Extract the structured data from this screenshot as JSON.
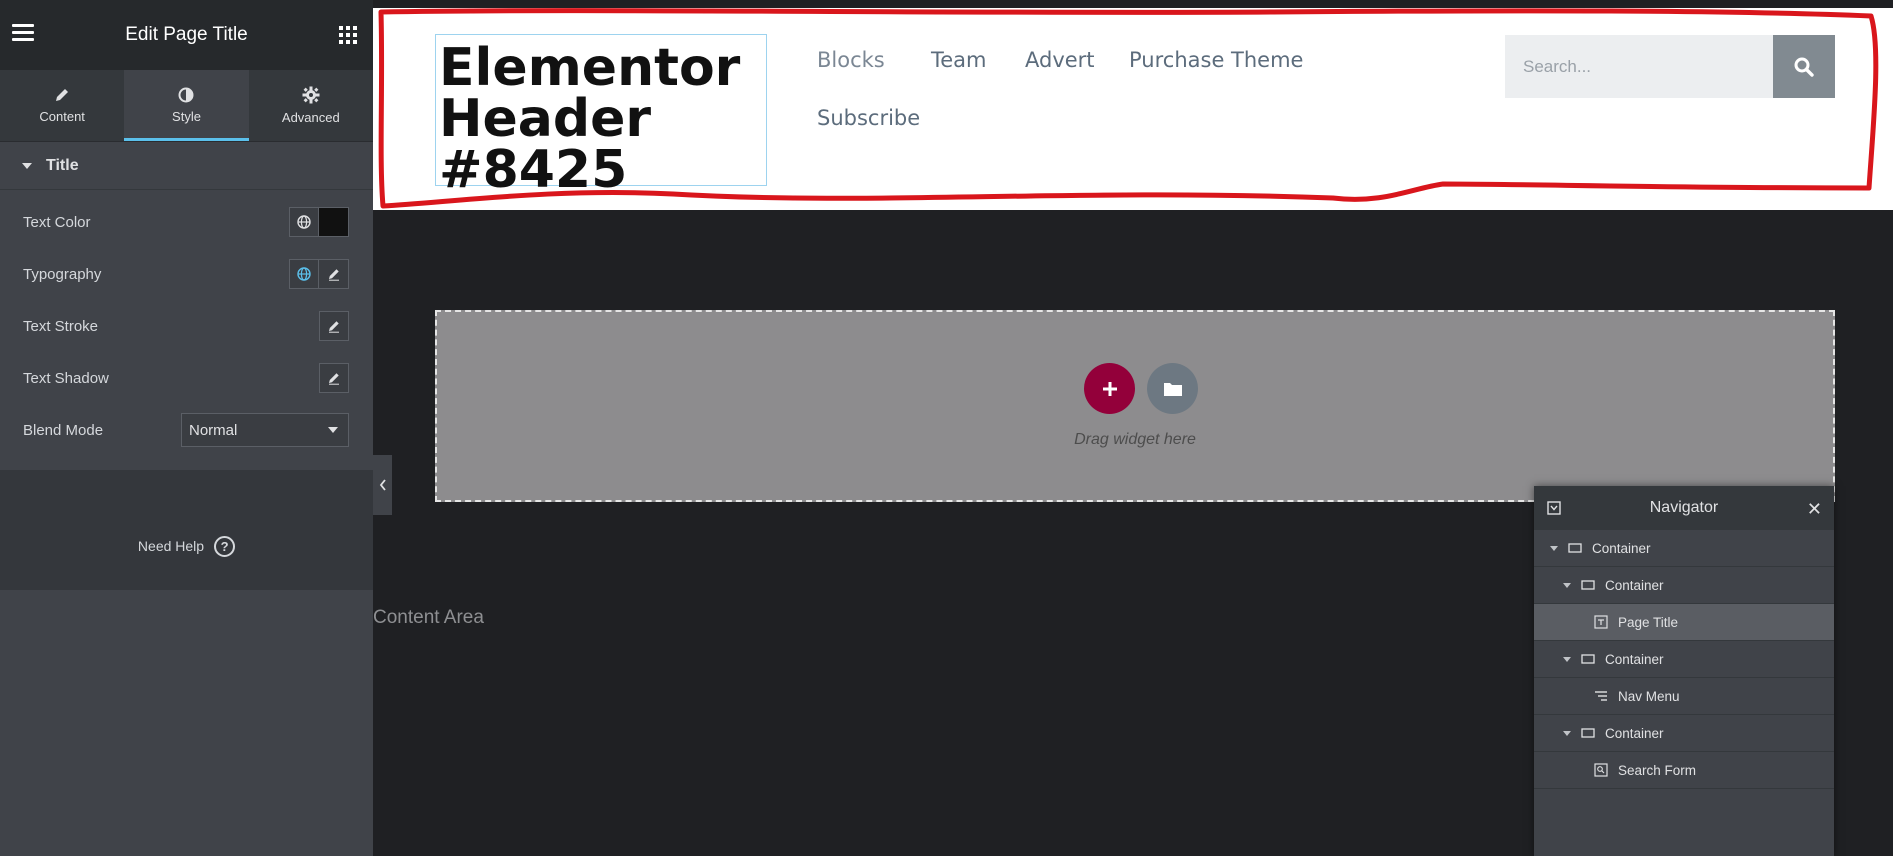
{
  "panel": {
    "title": "Edit Page Title",
    "tabs": [
      {
        "label": "Content",
        "icon": "pencil-icon"
      },
      {
        "label": "Style",
        "icon": "half-circle-icon"
      },
      {
        "label": "Advanced",
        "icon": "gear-icon"
      }
    ],
    "active_tab": "Style",
    "section_title": "Title",
    "controls": {
      "text_color": "Text Color",
      "typography": "Typography",
      "text_stroke": "Text Stroke",
      "text_shadow": "Text Shadow",
      "blend_mode": "Blend Mode",
      "blend_mode_value": "Normal"
    },
    "text_color_value": "#111111",
    "help_label": "Need Help",
    "help_symbol": "?"
  },
  "header": {
    "site_title_lines": [
      "Elementor",
      "Header",
      "#8425"
    ],
    "nav_items": [
      "Blocks",
      "Team",
      "Advert",
      "Purchase Theme",
      "Subscribe"
    ],
    "search_placeholder": "Search...",
    "highlight_color": "#d9161c"
  },
  "canvas": {
    "add_button_symbol": "+",
    "drop_hint": "Drag widget here",
    "content_area_label": "Content Area"
  },
  "navigator": {
    "title": "Navigator",
    "close_symbol": "✕",
    "items": [
      {
        "label": "Container",
        "icon": "container-icon",
        "expanded": true
      },
      {
        "label": "Container",
        "icon": "container-icon",
        "expanded": true
      },
      {
        "label": "Page Title",
        "icon": "page-title-icon",
        "selected": true
      },
      {
        "label": "Container",
        "icon": "container-icon",
        "expanded": true
      },
      {
        "label": "Nav Menu",
        "icon": "nav-menu-icon"
      },
      {
        "label": "Container",
        "icon": "container-icon",
        "expanded": true
      },
      {
        "label": "Search Form",
        "icon": "search-form-icon"
      }
    ]
  },
  "colors": {
    "accent": "#93003a",
    "panel_bg": "#404349",
    "tab_underline": "#5bc0eb"
  }
}
